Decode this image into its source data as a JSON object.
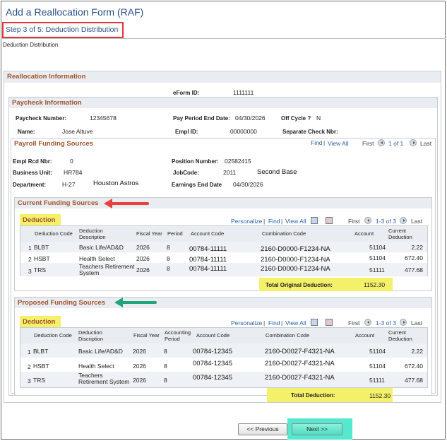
{
  "page": {
    "title": "Add a Reallocation Form (RAF)",
    "step": "Step 3 of 5: Deduction Distribution",
    "subtitle": "Deduction Distribution"
  },
  "realloc": {
    "header": "Reallocation Information",
    "eform_label": "eForm ID:",
    "eform_value": "1111111"
  },
  "paycheck": {
    "header": "Paycheck Information",
    "number_label": "Paycheck Number:",
    "number_value": "12345678",
    "ped_label": "Pay Period End Date:",
    "ped_value": "04/30/2026",
    "offcycle_label": "Off Cycle ?",
    "offcycle_value": "N",
    "name_label": "Name:",
    "name_value": "Jose Altuve",
    "emplid_label": "Empl ID:",
    "emplid_value": "00000000",
    "sep_label": "Separate Check Nbr:"
  },
  "funding": {
    "header": "Payroll Funding Sources",
    "find": "Find",
    "viewall": "View All",
    "first": "First",
    "range": "1 of 1",
    "last": "Last",
    "rcd_label": "Empl Rcd Nbr:",
    "rcd_value": "0",
    "pos_label": "Position Number:",
    "pos_value": "02582415",
    "bu_label": "Business Unit:",
    "bu_value": "HR784",
    "jobcode_label": "JobCode:",
    "jobcode_value": "2011",
    "jobcode_desc": "Second Base",
    "dept_label": "Department:",
    "dept_code": "H-27",
    "dept_desc": "Houston Astros",
    "eed_label": "Earnings End Date",
    "eed_value": "04/30/2026"
  },
  "current": {
    "header": "Current Funding Sources",
    "grid_title": "Deduction",
    "personalize": "Personalize",
    "find": "Find",
    "viewall": "View All",
    "first": "First",
    "range": "1-3 of 3",
    "last": "Last",
    "columns": [
      "Deduction Code",
      "Deduction Description",
      "Fiscal Year",
      "Period",
      "Account Code",
      "Combination Code",
      "Account",
      "Current Deduction"
    ],
    "rows": [
      {
        "n": "1",
        "code": "BLBT",
        "desc": "Basic Life/AD&D",
        "fy": "2026",
        "period": "8",
        "acct_code": "00784-11111",
        "combo": "2160-D0000-F1234-NA",
        "account": "51104",
        "amount": "2.22"
      },
      {
        "n": "2",
        "code": "HSBT",
        "desc": "Health Select",
        "fy": "2026",
        "period": "8",
        "acct_code": "00784-11111",
        "combo": "2160-D0000-F1234-NA",
        "account": "51104",
        "amount": "672.40"
      },
      {
        "n": "3",
        "code": "TRS",
        "desc": "Teachers Retirement System",
        "fy": "2026",
        "period": "8",
        "acct_code": "00784-11111",
        "combo": "2160-D0000-F1234-NA",
        "account": "51111",
        "amount": "477.68"
      }
    ],
    "total_label": "Total Original Deduction:",
    "total_value": "1152.30"
  },
  "proposed": {
    "header": "Proposed Funding Sources",
    "grid_title": "Deduction",
    "personalize": "Personalize",
    "find": "Find",
    "viewall": "View All",
    "first": "First",
    "range": "1-3 of 3",
    "last": "Last",
    "columns": [
      "Deduction Code",
      "Deduction Discription",
      "Fiscal Year",
      "Accounting Period",
      "Account Code",
      "Combination Code",
      "Account",
      "Current Deduction"
    ],
    "rows": [
      {
        "n": "1",
        "code": "BLBT",
        "desc": "Basic Life/AD&D",
        "fy": "2026",
        "period": "8",
        "acct_code": "00784-12345",
        "combo": "2160-D0027-F4321-NA",
        "account": "51104",
        "amount": "2.22"
      },
      {
        "n": "2",
        "code": "HSBT",
        "desc": "Health Select",
        "fy": "2026",
        "period": "8",
        "acct_code": "00784-12345",
        "combo": "2160-D0027-F4321-NA",
        "account": "51104",
        "amount": "672.40"
      },
      {
        "n": "3",
        "code": "TRS",
        "desc": "Teachers Retirement System",
        "fy": "2026",
        "period": "8",
        "acct_code": "00784-12345",
        "combo": "2160-D0027-F4321-NA",
        "account": "51111",
        "amount": "477.68"
      }
    ],
    "total_label": "Total Deduction:",
    "total_value": "1152.30"
  },
  "nav": {
    "prev": "<< Previous",
    "next": "Next >>"
  },
  "colors": {
    "highlight_yellow": "#f5f06a",
    "highlight_cyan": "#56e8cf",
    "step_border": "#e0353a",
    "arrow_red": "#e8403c",
    "arrow_green": "#22a57b"
  }
}
